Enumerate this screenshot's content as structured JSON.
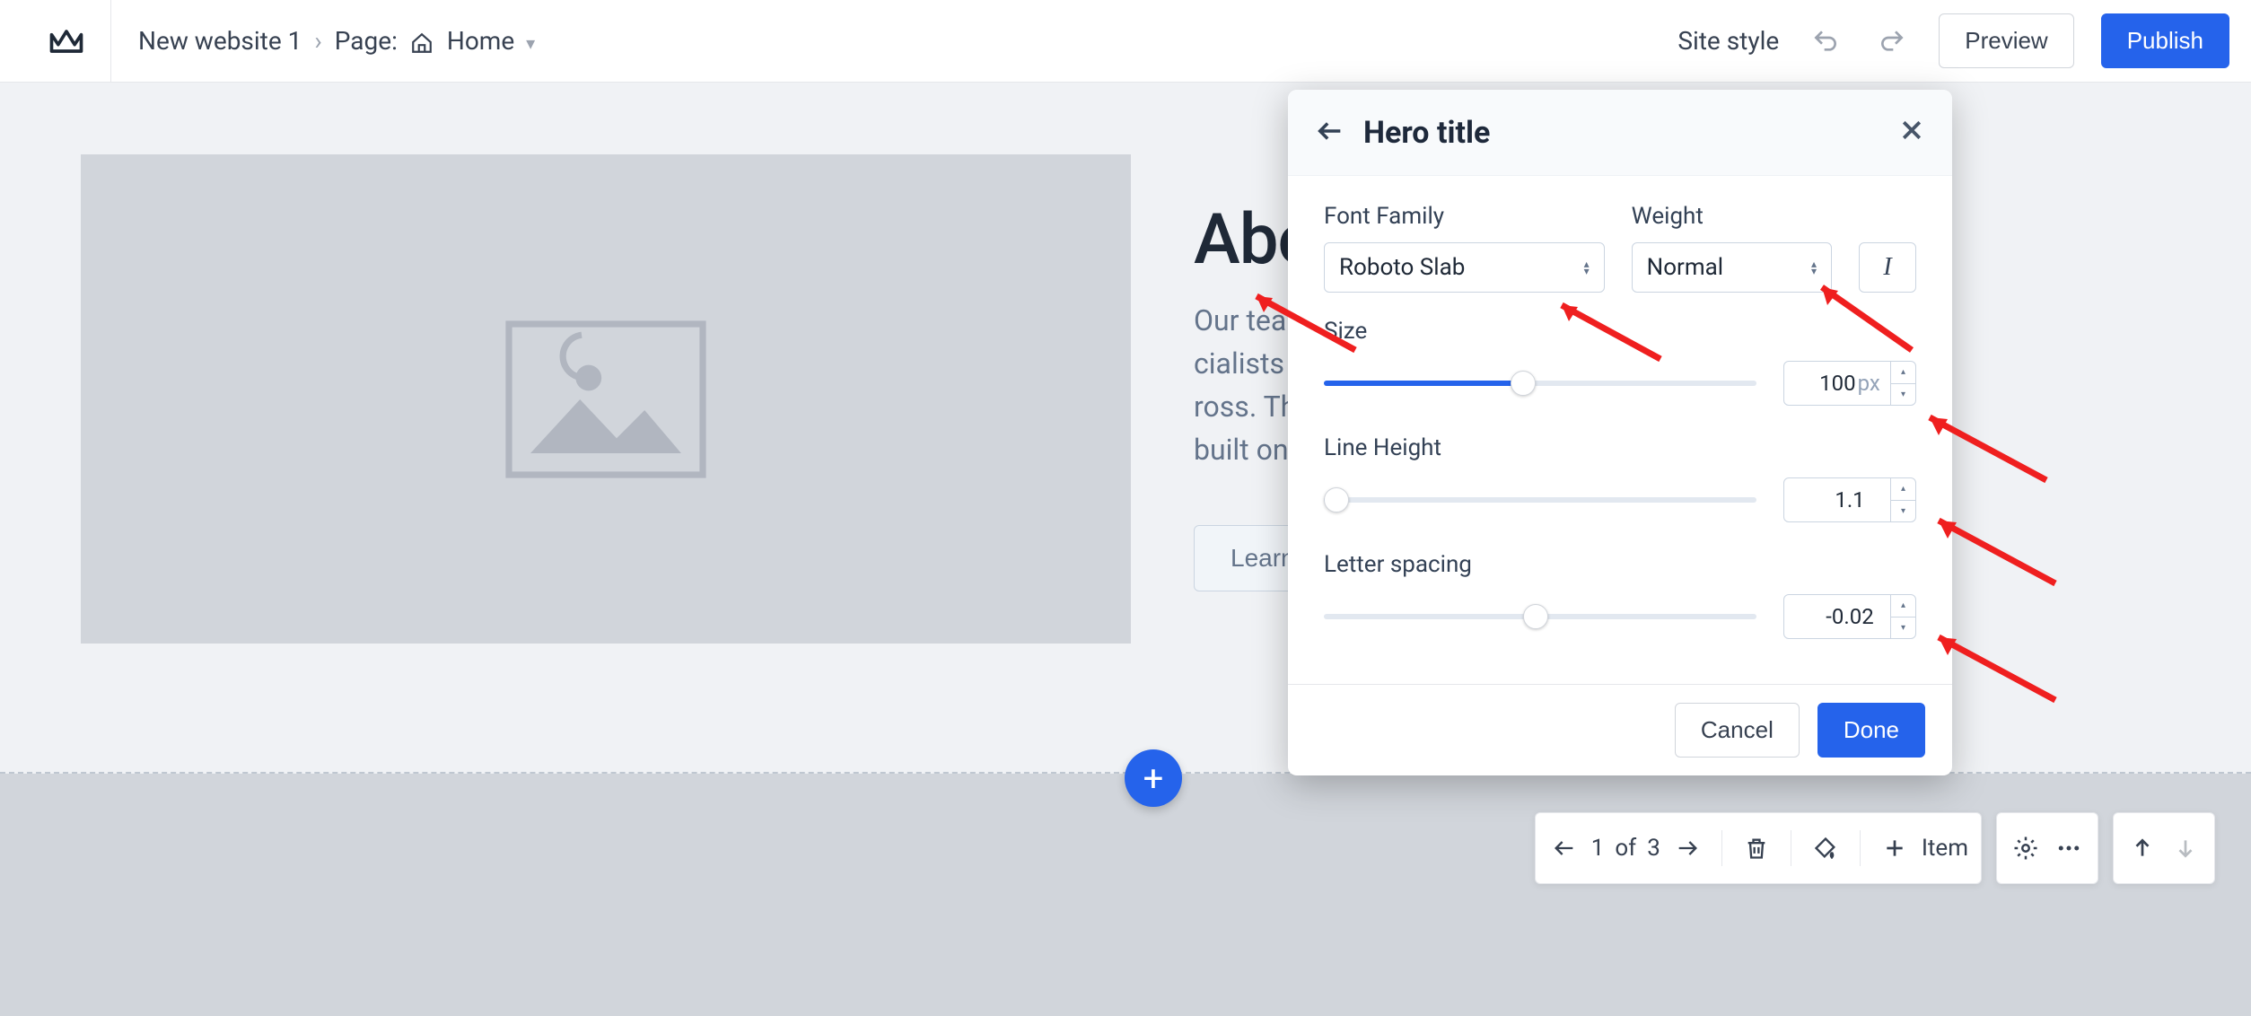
{
  "header": {
    "site_name": "New website 1",
    "page_label": "Page:",
    "page_name": "Home",
    "site_style": "Site style",
    "preview": "Preview",
    "publish": "Publish"
  },
  "canvas": {
    "hero_title": "Abo",
    "body": "Our tea                                                                                                                           cialists who know h                                                                                                                         ross. This creates                                                                                                                           built on trust ar",
    "learn": "Learn"
  },
  "panel": {
    "title": "Hero title",
    "font_family_label": "Font Family",
    "font_family_value": "Roboto Slab",
    "weight_label": "Weight",
    "weight_value": "Normal",
    "italic_label": "I",
    "size_label": "Size",
    "size_value": "100",
    "size_unit": "px",
    "line_height_label": "Line Height",
    "line_height_value": "1.1",
    "letter_spacing_label": "Letter spacing",
    "letter_spacing_value": "-0.02",
    "cancel": "Cancel",
    "done": "Done"
  },
  "toolbar": {
    "page_current": "1",
    "page_of": "of",
    "page_total": "3",
    "item": "Item"
  }
}
